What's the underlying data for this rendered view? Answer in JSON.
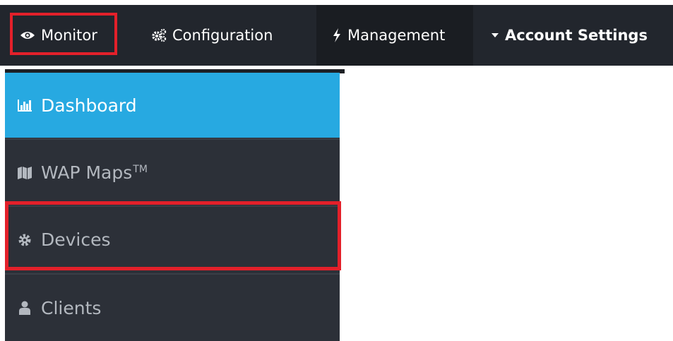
{
  "topnav": {
    "items": [
      {
        "label": "Monitor",
        "icon": "eye-icon"
      },
      {
        "label": "Configuration",
        "icon": "cogs-icon"
      },
      {
        "label": "Management",
        "icon": "bolt-icon"
      },
      {
        "label": "Account Settings",
        "icon": "caret-down-icon"
      }
    ]
  },
  "sidebar": {
    "items": [
      {
        "label": "Dashboard",
        "icon": "bar-chart-icon",
        "active": true
      },
      {
        "label": "WAP Maps",
        "suffix": "TM",
        "icon": "map-icon"
      },
      {
        "label": "Devices",
        "icon": "gear-icon"
      },
      {
        "label": "Clients",
        "icon": "user-icon"
      }
    ]
  },
  "colors": {
    "topbar_bg": "#22262d",
    "sidebar_bg": "#2c3038",
    "active_bg": "#27a9e1",
    "highlight": "#e3202a"
  }
}
